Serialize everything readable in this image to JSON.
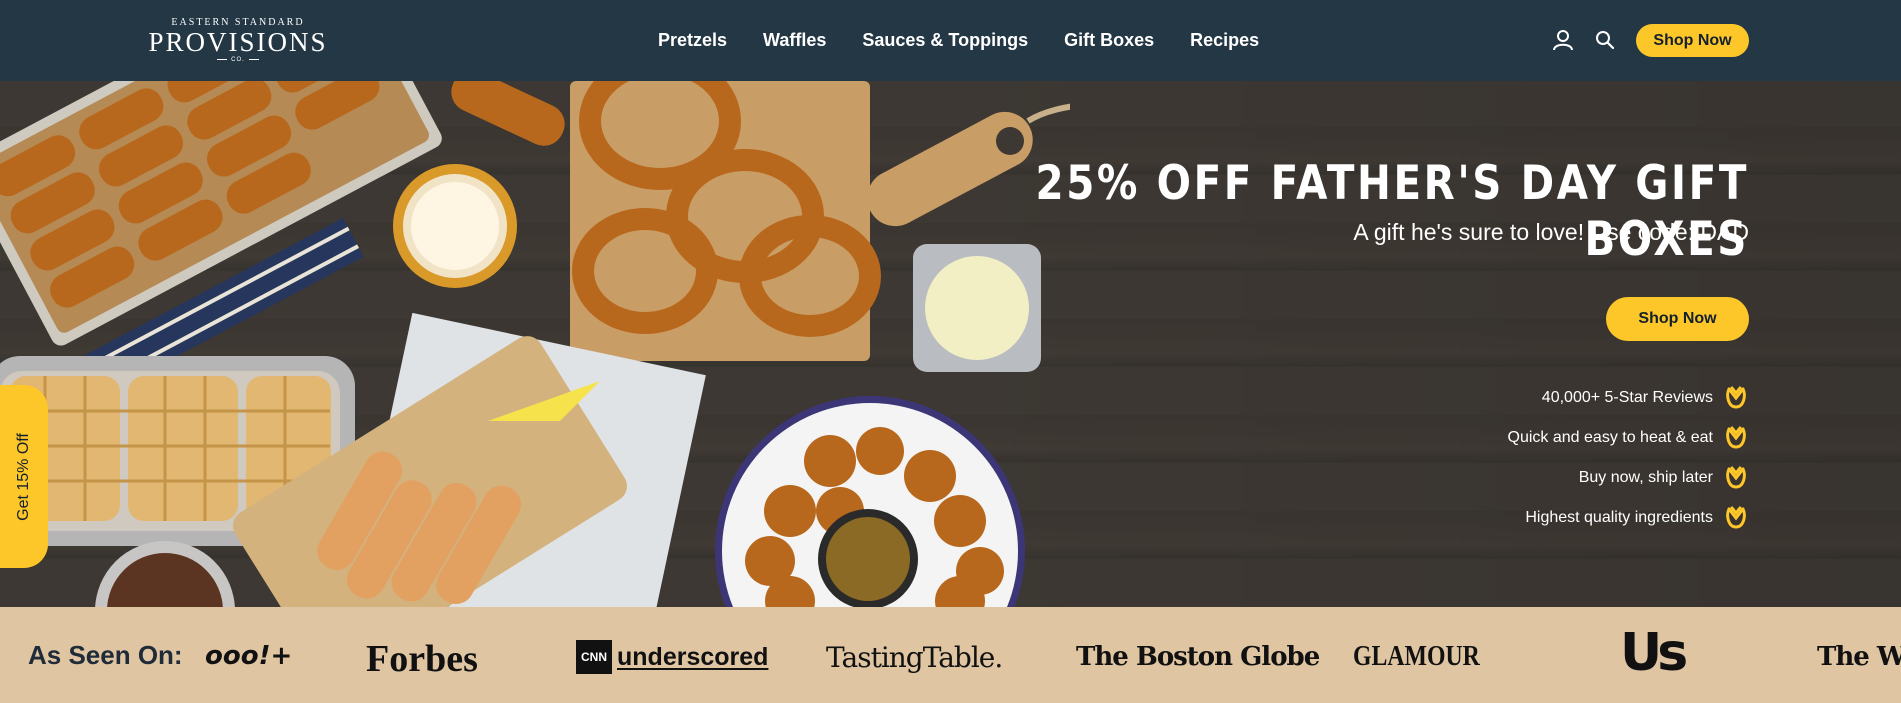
{
  "header": {
    "logo": {
      "top": "EASTERN STANDARD",
      "main": "PROVISIONS",
      "small": "CO."
    },
    "nav": [
      "Pretzels",
      "Waffles",
      "Sauces & Toppings",
      "Gift Boxes",
      "Recipes"
    ],
    "icons": {
      "account": "user-icon",
      "search": "search-icon"
    },
    "cta": "Shop Now"
  },
  "hero": {
    "title": "25% OFF FATHER'S DAY GIFT BOXES",
    "subtitle": "A gift he's sure to love! Use code: DAD",
    "cta": "Shop Now",
    "features": [
      {
        "label": "40,000+ 5-Star Reviews",
        "icon": "pretzel-icon"
      },
      {
        "label": "Quick and easy to heat & eat",
        "icon": "pretzel-icon"
      },
      {
        "label": "Buy now, ship later",
        "icon": "pretzel-icon"
      },
      {
        "label": "Highest quality ingredients",
        "icon": "pretzel-icon"
      }
    ],
    "side_tab": "Get 15% Off"
  },
  "press": {
    "label": "As Seen On:",
    "logos": {
      "yahoo": "ooo!+",
      "forbes": "Forbes",
      "cnn_badge": "CNN",
      "cnn_text": "underscored",
      "tasting": "TastingTable.",
      "boston": "The Boston Globe",
      "glamour": "GLAMOUR",
      "us": "Us",
      "wash": "The Wash"
    }
  },
  "colors": {
    "header_bg": "#243745",
    "accent": "#fdc72a",
    "press_bg": "#dfc5a2",
    "hero_bg": "#3d3833"
  }
}
